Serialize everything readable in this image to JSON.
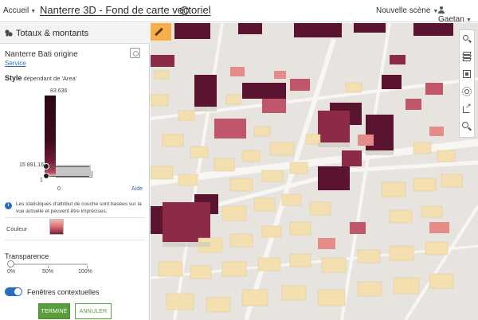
{
  "topbar": {
    "home_label": "Accueil",
    "scene_title": "Nanterre 3D - Fond de carte vectoriel",
    "new_scene_label": "Nouvelle scène",
    "user_name": "Gaetan"
  },
  "panel": {
    "title": "Totaux & montants",
    "layer_name": "Nanterre Bati origine",
    "service_link": "Service",
    "style_label": "Style",
    "style_sub": "dépendant de 'Area'",
    "slider": {
      "max_value": "83 636",
      "mid_value": "15 891,16",
      "min_value": "1",
      "axis_zero": "0",
      "help_link": "Aide"
    },
    "info_text": "Les statistiques d'attribut de couche sont basées sur la vue actuelle et peuvent être imprécises.",
    "color_label": "Couleur",
    "transparency": {
      "title": "Transparence",
      "value_fraction": 0,
      "ticks": [
        "0%",
        "50%",
        "100%"
      ]
    },
    "popups": {
      "label": "Fenêtres contextuelles",
      "enabled": true
    },
    "buttons": {
      "done": "TERMINÉ",
      "cancel": "ANNULER"
    }
  },
  "colors": {
    "accent_green": "#5a9e3c",
    "link_blue": "#2a6ebb",
    "ramp_dark": "#2a0716",
    "ramp_light": "#f0c9b8"
  },
  "map_tools": [
    "search-icon",
    "layers-icon",
    "basemap-icon",
    "daylight-icon",
    "share-icon",
    "zoom-find-icon"
  ]
}
